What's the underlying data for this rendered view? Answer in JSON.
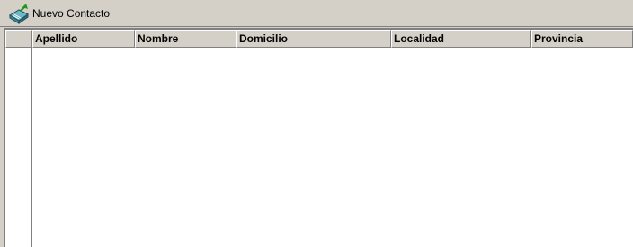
{
  "toolbar": {
    "new_contact_label": "Nuevo Contacto",
    "new_contact_icon": "new-contact-icon"
  },
  "grid": {
    "columns": [
      "Apellido",
      "Nombre",
      "Domicilio",
      "Localidad",
      "Provincia"
    ],
    "rows": []
  },
  "colors": {
    "window_bg": "#d4d0c8",
    "grid_bg": "#ffffff",
    "shadow": "#808080"
  }
}
